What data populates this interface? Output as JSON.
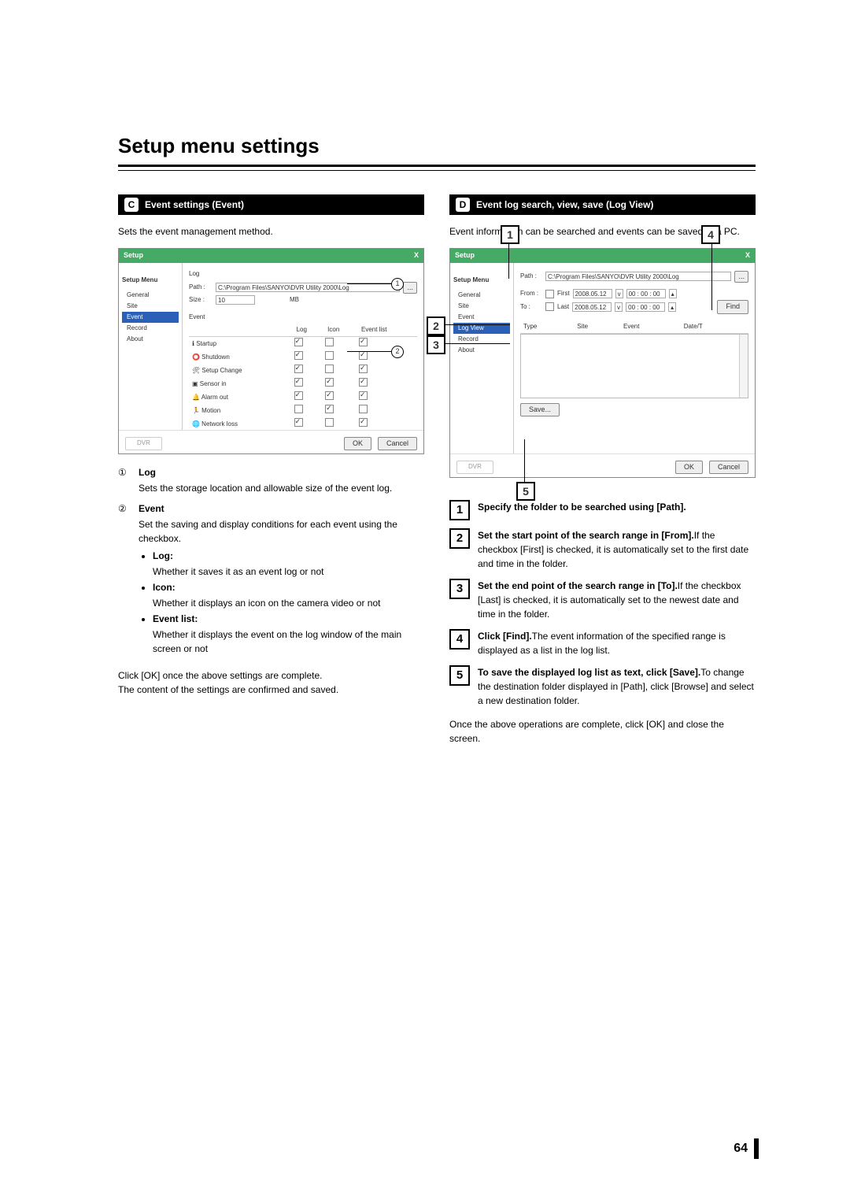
{
  "title": "Setup menu settings",
  "sections": {
    "c": {
      "badge": "C",
      "title": "Event settings (Event)",
      "intro": "Sets the event management method."
    },
    "d": {
      "badge": "D",
      "title": "Event log search, view, save (Log View)",
      "intro": "Event information can be searched and events can be saved to a PC."
    }
  },
  "shot_common": {
    "window_title": "Setup",
    "close": "X",
    "menu_header": "Setup Menu",
    "tree": [
      "General",
      "Site",
      "Event",
      "Log View",
      "Record",
      "About"
    ],
    "dvr": "DVR",
    "ok": "OK",
    "cancel": "Cancel"
  },
  "shot_c": {
    "group": "Log",
    "path_label": "Path :",
    "path_value": "C:\\Program Files\\SANYO\\DVR Utility 2000\\Log",
    "browse": "...",
    "size_label": "Size :",
    "size_value": "10",
    "size_unit": "MB",
    "event_group": "Event",
    "cols": [
      "Log",
      "Icon",
      "Event list"
    ],
    "rows": [
      {
        "icon": "ℹ",
        "name": "Startup",
        "c": [
          true,
          false,
          true
        ]
      },
      {
        "icon": "⭕",
        "name": "Shutdown",
        "c": [
          true,
          false,
          true
        ]
      },
      {
        "icon": "🛠",
        "name": "Setup Change",
        "c": [
          true,
          false,
          true
        ]
      },
      {
        "icon": "▣",
        "name": "Sensor in",
        "c": [
          true,
          true,
          true
        ]
      },
      {
        "icon": "🔔",
        "name": "Alarm out",
        "c": [
          true,
          true,
          true
        ]
      },
      {
        "icon": "🏃",
        "name": "Motion",
        "c": [
          false,
          true,
          false
        ]
      },
      {
        "icon": "🌐",
        "name": "Network loss",
        "c": [
          true,
          false,
          true
        ]
      }
    ]
  },
  "shot_d": {
    "path_label": "Path :",
    "path_value": "C:\\Program Files\\SANYO\\DVR Utility 2000\\Log",
    "browse": "...",
    "from": "From :",
    "first": "First",
    "to": "To :",
    "last": "Last",
    "date1": "2008.05.12",
    "time1": "00 : 00 : 00",
    "find": "Find",
    "date2": "2008.05.12",
    "time2": "00 : 00 : 00",
    "listcols": [
      "Type",
      "Site",
      "Event",
      "Date/T"
    ],
    "save": "Save..."
  },
  "left_items": {
    "n1": {
      "num": "①",
      "head": "Log",
      "body": "Sets the storage location and allowable size of the event log."
    },
    "n2": {
      "num": "②",
      "head": "Event",
      "body": "Set the saving and display conditions for each event using the checkbox.",
      "bullets": [
        {
          "h": "Log:",
          "b": "Whether it saves it as an event log or not"
        },
        {
          "h": "Icon:",
          "b": "Whether it displays an icon on the camera video or not"
        },
        {
          "h": "Event list:",
          "b": "Whether it displays the event on the log window of the main screen or not"
        }
      ]
    },
    "closing1": "Click [OK] once the above settings are complete.",
    "closing2": "The content of the settings are confirmed and saved."
  },
  "right_steps": [
    {
      "n": "1",
      "h": "Specify the folder to be searched using [Path].",
      "b": ""
    },
    {
      "n": "2",
      "h": "Set the start point of the search range in [From].",
      "b": "If the checkbox [First] is checked, it is automatically set to the first date and time in the folder."
    },
    {
      "n": "3",
      "h": "Set the end point of the search range in [To].",
      "b": "If the checkbox [Last] is checked, it is automatically set to the newest date and time in the folder."
    },
    {
      "n": "4",
      "h": "Click [Find].",
      "b": "The event information of the specified range is displayed as a list in the log list."
    },
    {
      "n": "5",
      "h": "To save the displayed log list as text, click [Save].",
      "b": "To change the destination folder displayed in [Path], click [Browse] and select a new destination folder."
    }
  ],
  "right_closing": "Once the above operations are complete, click [OK] and close the screen.",
  "pagenum": "64"
}
